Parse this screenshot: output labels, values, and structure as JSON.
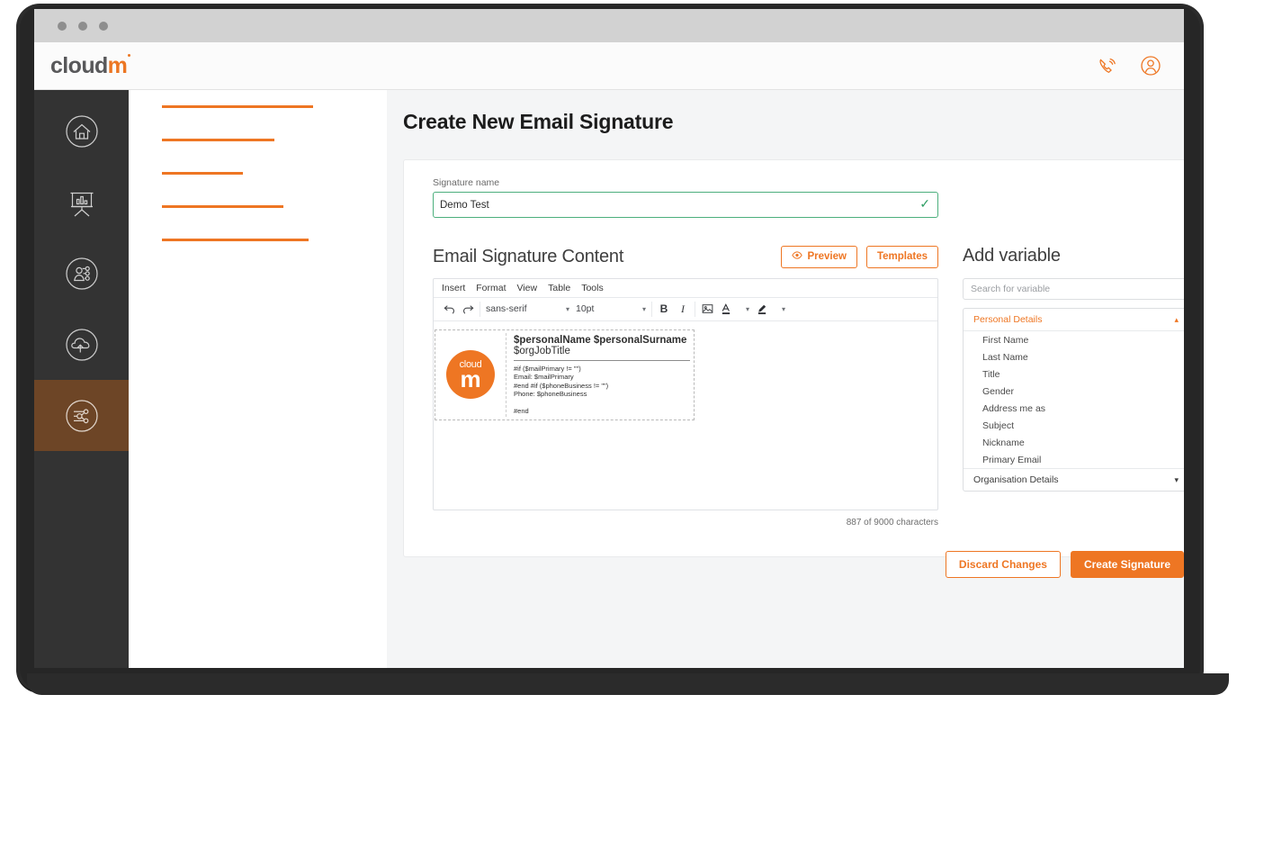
{
  "window": {
    "dots": [
      "dot-1",
      "dot-2",
      "dot-3"
    ]
  },
  "header": {
    "brand_main": "cloud",
    "brand_accent": "m",
    "support_icon": "phone-support-icon",
    "account_icon": "user-account-icon"
  },
  "sidebar": {
    "items": [
      {
        "name": "home",
        "icon": "home-icon",
        "active": false
      },
      {
        "name": "reports",
        "icon": "presentation-chart-icon",
        "active": false
      },
      {
        "name": "users",
        "icon": "users-icon",
        "active": false
      },
      {
        "name": "migrate",
        "icon": "cloud-upload-icon",
        "active": false
      },
      {
        "name": "signatures",
        "icon": "signature-share-icon",
        "active": true
      }
    ]
  },
  "nav_placeholder": {
    "bars": [
      168,
      125,
      90,
      135,
      163
    ]
  },
  "main": {
    "page_title": "Create New Email Signature",
    "signature_name": {
      "label": "Signature name",
      "value": "Demo Test",
      "valid_icon": "check-icon"
    },
    "editor": {
      "title": "Email Signature Content",
      "preview_label": "Preview",
      "preview_icon": "eye-icon",
      "templates_label": "Templates",
      "menubar": [
        "Insert",
        "Format",
        "View",
        "Table",
        "Tools"
      ],
      "toolbar": {
        "undo_icon": "undo-icon",
        "redo_icon": "redo-icon",
        "font_family": "sans-serif",
        "font_size": "10pt",
        "bold_label": "B",
        "italic_label": "I",
        "image_icon": "insert-image-icon",
        "text_color_label": "A",
        "text_color_icon": "text-color-icon",
        "highlight_icon": "highlight-color-icon"
      },
      "signature_preview": {
        "logo_word": "cloud",
        "logo_letter": "m",
        "name_line": "$personalName $personalSurname",
        "job_line": "$orgJobTitle",
        "code_lines": [
          "#if ($mailPrimary != \"\")",
          "Email: $mailPrimary",
          "#end #if ($phoneBusiness != \"\")",
          "Phone: $phoneBusiness"
        ],
        "code_end": "#end"
      },
      "char_count": "887 of 9000 characters"
    },
    "variables": {
      "title": "Add variable",
      "search_placeholder": "Search for variable",
      "groups": [
        {
          "label": "Personal Details",
          "open": true,
          "chevron": "chevron-up-icon",
          "items": [
            "First Name",
            "Last Name",
            "Title",
            "Gender",
            "Address me as",
            "Subject",
            "Nickname",
            "Primary Email"
          ]
        },
        {
          "label": "Organisation Details",
          "open": false,
          "chevron": "chevron-down-icon",
          "items": []
        }
      ]
    },
    "footer": {
      "discard_label": "Discard Changes",
      "create_label": "Create Signature"
    }
  },
  "colors": {
    "accent_orange": "#ee7623",
    "sidebar_dark": "#333333",
    "sidebar_active": "#6d4526",
    "valid_green": "#4caf7d",
    "page_bg": "#f4f5f6"
  }
}
